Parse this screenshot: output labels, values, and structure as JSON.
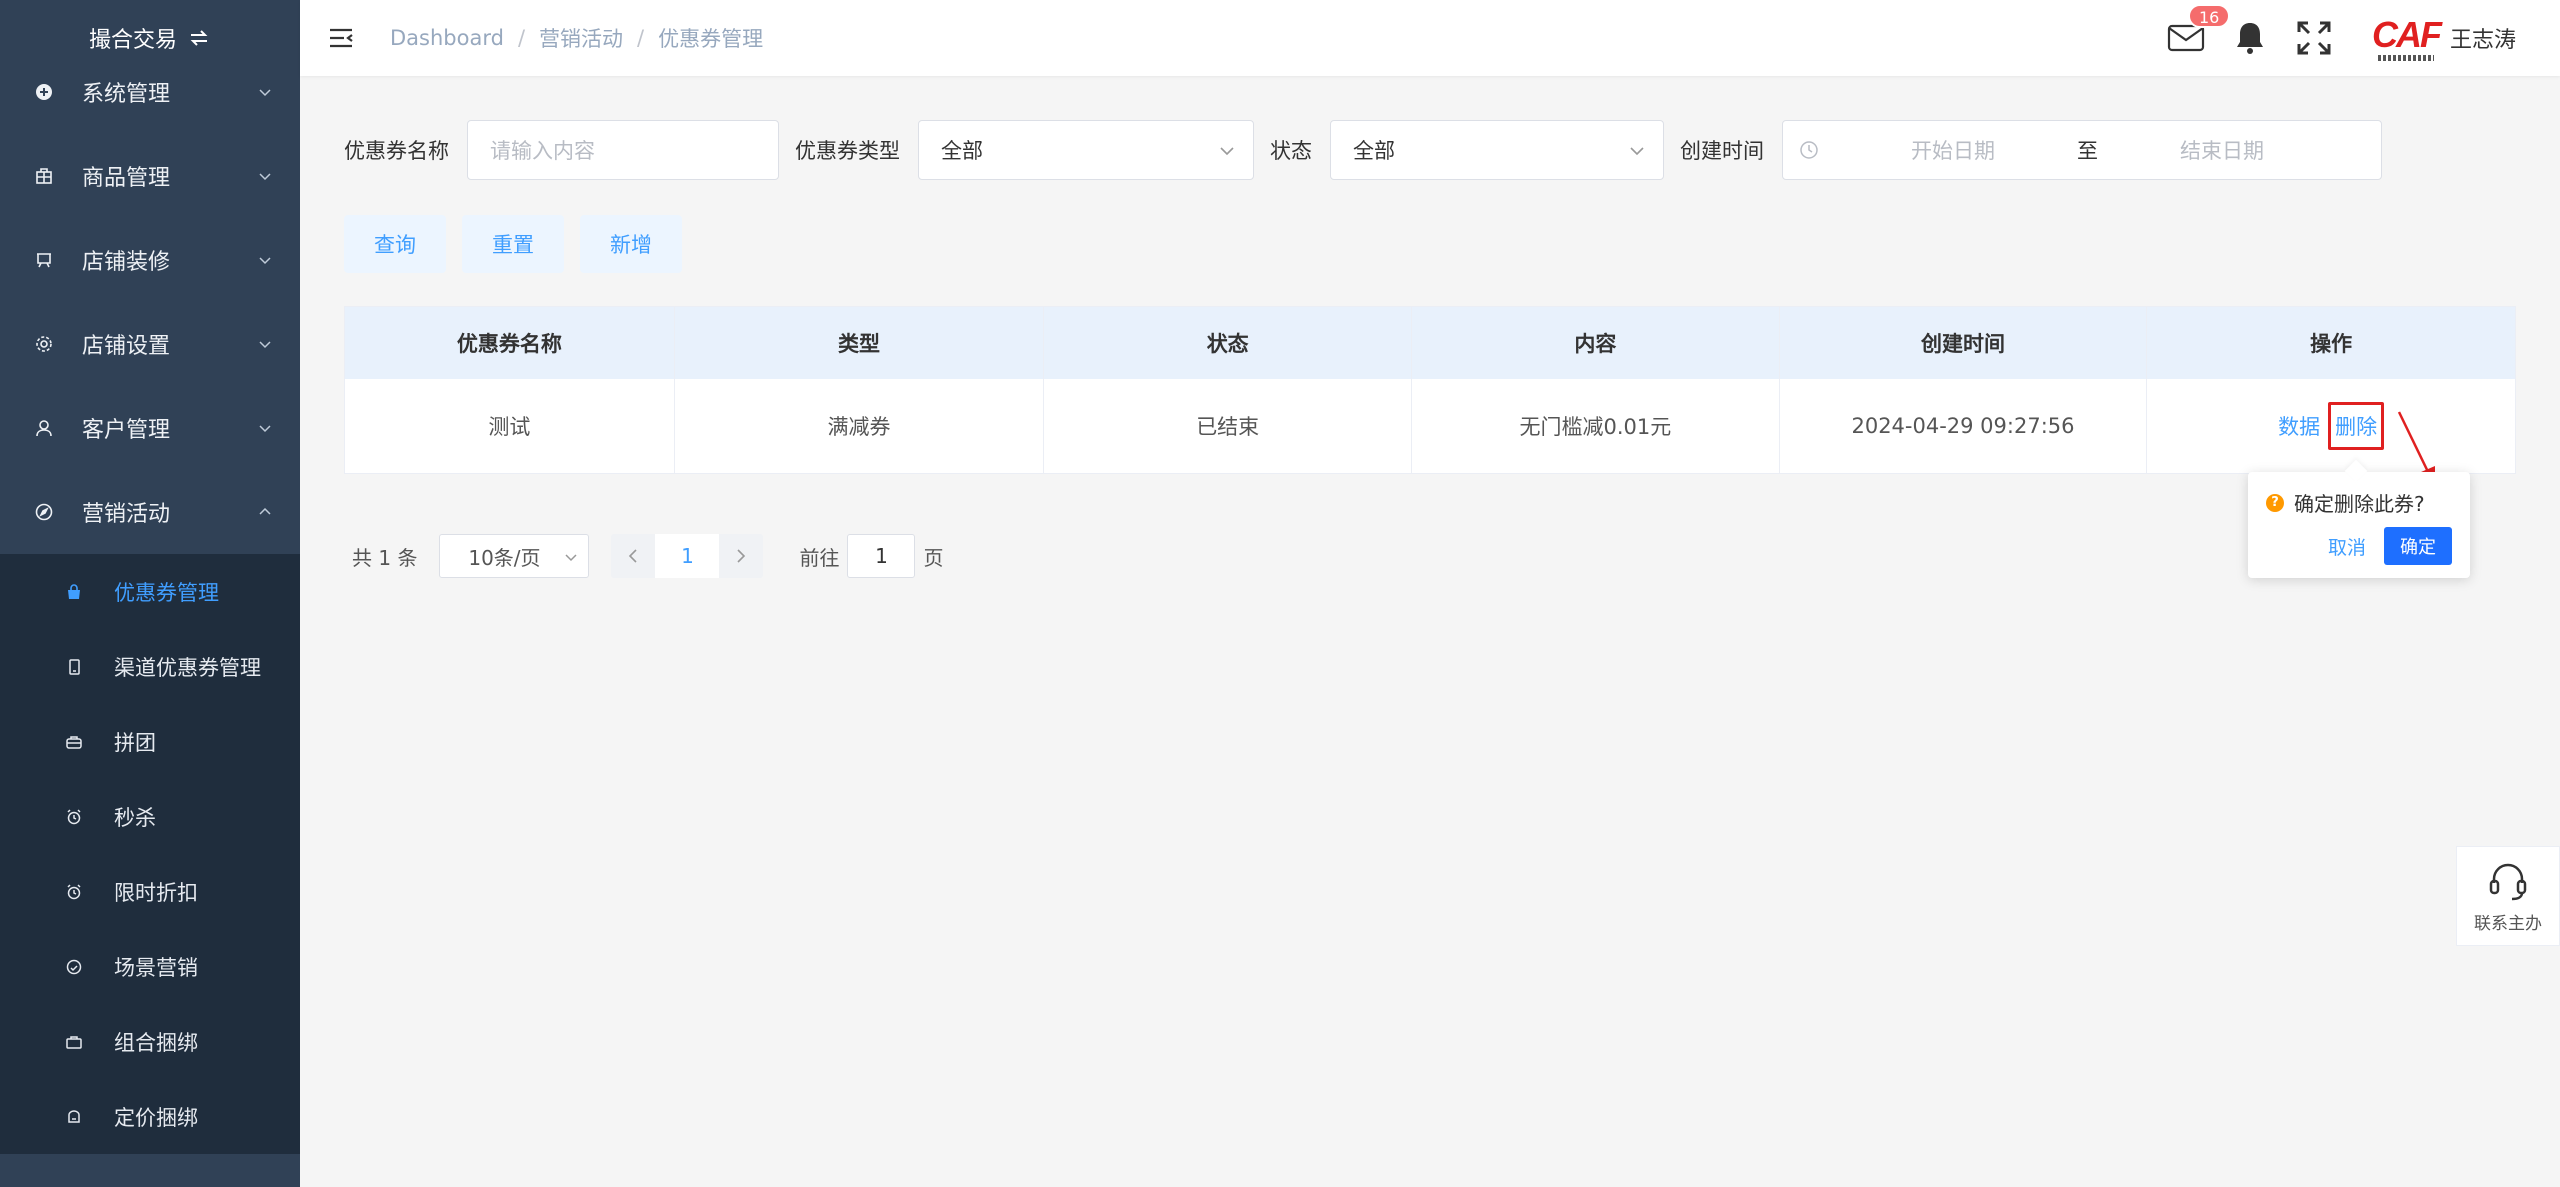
{
  "sidebar": {
    "title": "撮合交易",
    "menus": [
      {
        "label": "系统管理",
        "icon": "plus-circle-icon"
      },
      {
        "label": "商品管理",
        "icon": "goods-icon"
      },
      {
        "label": "店铺装修",
        "icon": "monitor-icon"
      },
      {
        "label": "店铺设置",
        "icon": "gear-icon"
      },
      {
        "label": "客户管理",
        "icon": "user-icon"
      },
      {
        "label": "营销活动",
        "icon": "compass-icon"
      }
    ],
    "submenu": [
      {
        "label": "优惠券管理",
        "icon": "bag-icon",
        "active": true
      },
      {
        "label": "渠道优惠券管理",
        "icon": "phone-icon"
      },
      {
        "label": "拼团",
        "icon": "group-icon"
      },
      {
        "label": "秒杀",
        "icon": "alarm-icon"
      },
      {
        "label": "限时折扣",
        "icon": "alarm-icon"
      },
      {
        "label": "场景营销",
        "icon": "smile-icon"
      },
      {
        "label": "组合捆绑",
        "icon": "briefcase-icon"
      },
      {
        "label": "定价捆绑",
        "icon": "box-icon"
      }
    ]
  },
  "header": {
    "breadcrumb": [
      "Dashboard",
      "营销活动",
      "优惠券管理"
    ],
    "mail_badge": "16",
    "user_name": "王志涛",
    "logo_text": "CAF"
  },
  "filters": {
    "name_label": "优惠券名称",
    "name_placeholder": "请输入内容",
    "type_label": "优惠券类型",
    "type_value": "全部",
    "status_label": "状态",
    "status_value": "全部",
    "date_label": "创建时间",
    "date_start_placeholder": "开始日期",
    "date_sep": "至",
    "date_end_placeholder": "结束日期"
  },
  "buttons": {
    "query": "查询",
    "reset": "重置",
    "add": "新增"
  },
  "table": {
    "headers": [
      "优惠券名称",
      "类型",
      "状态",
      "内容",
      "创建时间",
      "操作"
    ],
    "rows": [
      {
        "name": "测试",
        "type": "满减券",
        "status": "已结束",
        "content": "无门槛减0.01元",
        "created": "2024-04-29 09:27:56",
        "action_data": "数据",
        "action_delete": "删除"
      }
    ]
  },
  "popconfirm": {
    "title": "确定删除此券?",
    "cancel": "取消",
    "confirm": "确定"
  },
  "pagination": {
    "total": "共 1 条",
    "page_size": "10条/页",
    "current": "1",
    "goto_label": "前往",
    "goto_value": "1",
    "goto_suffix": "页"
  },
  "contact": {
    "label": "联系主办"
  },
  "colors": {
    "sidebar_bg": "#304156",
    "accent": "#409eff",
    "confirm_btn": "#1e6fff",
    "highlight_red": "#e02020"
  }
}
